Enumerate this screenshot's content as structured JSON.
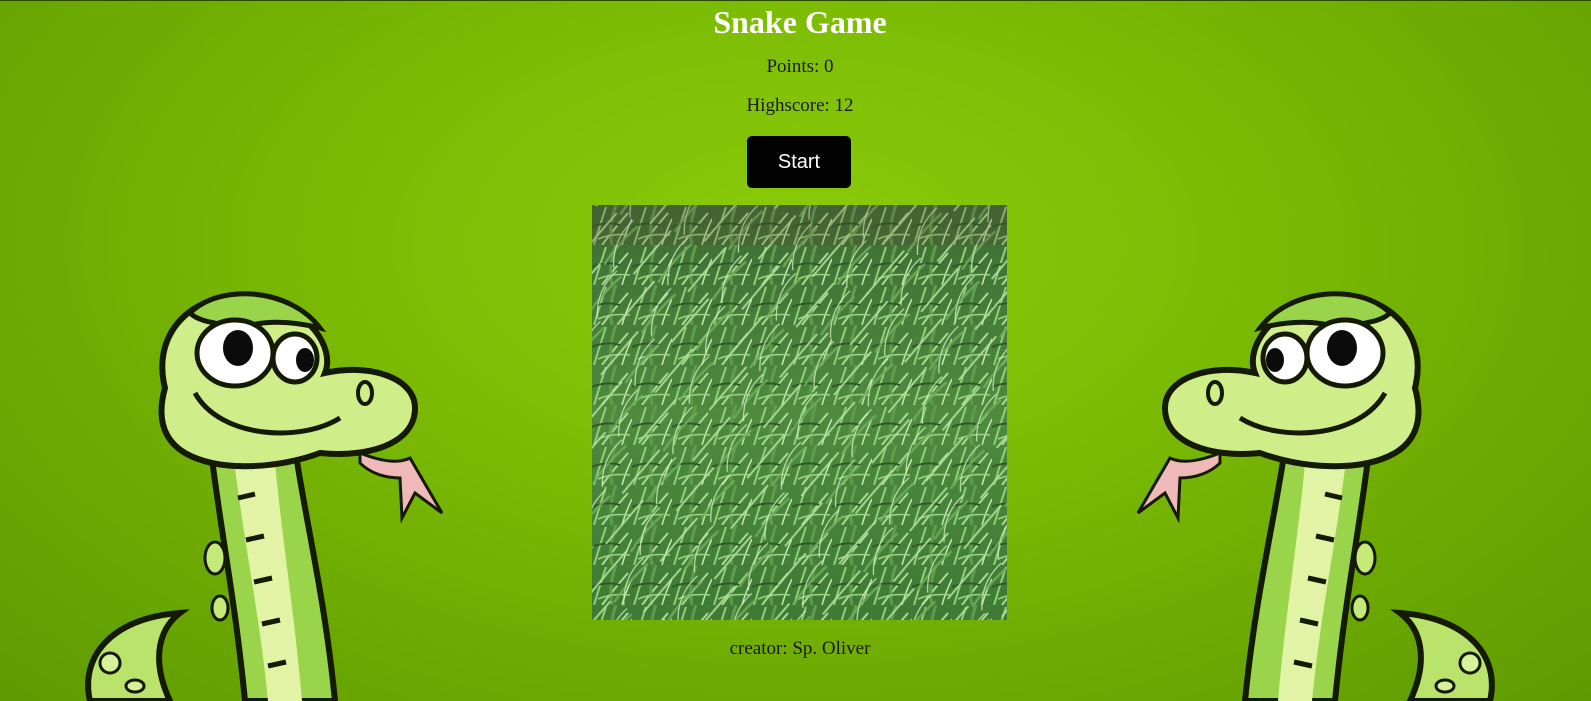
{
  "game": {
    "title": "Snake Game",
    "points_text": "Points: 0",
    "highscore_text": "Highscore: 12",
    "start_label": "Start",
    "credit_text": "creator: Sp. Oliver"
  },
  "colors": {
    "background": "#7dbd05",
    "title": "#ffffff",
    "button_bg": "#030303",
    "button_text": "#ffffff",
    "board_grass": "#4a8a3a"
  },
  "icons": {
    "left_mascot": "cartoon-snake-icon",
    "right_mascot": "cartoon-snake-icon"
  }
}
